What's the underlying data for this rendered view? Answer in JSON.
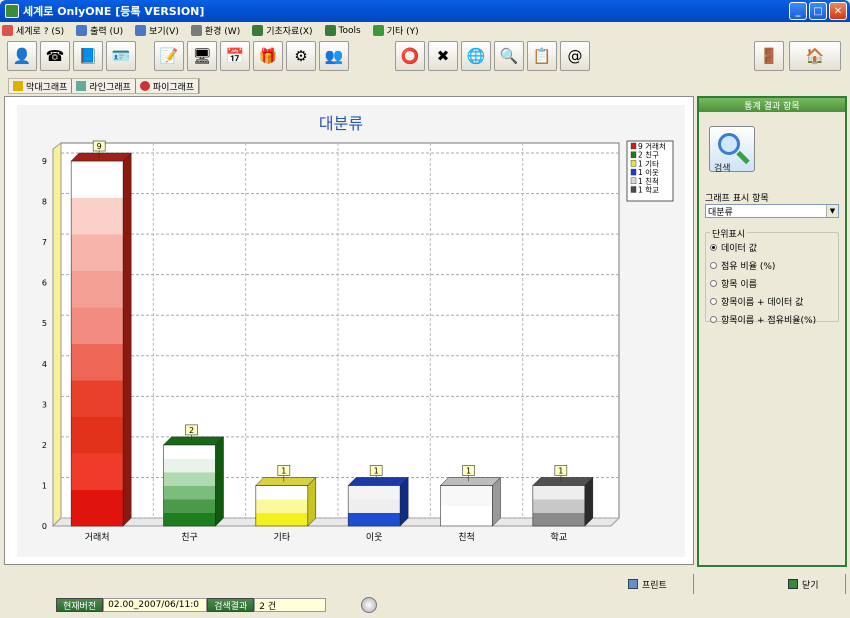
{
  "window": {
    "title": "세계로 OnlyONE [등록 VERSION]"
  },
  "menu": [
    {
      "label": "세계로 ? (S)",
      "icon": "person-icon",
      "color": "#d9534f"
    },
    {
      "label": "출력 (U)",
      "icon": "printer-icon",
      "color": "#4a78c2"
    },
    {
      "label": "보기(V)",
      "icon": "magnifier-icon",
      "color": "#4a78c2"
    },
    {
      "label": "환경 (W)",
      "icon": "settings-icon",
      "color": "#7a7a7a"
    },
    {
      "label": "기초자료(X)",
      "icon": "database-icon",
      "color": "#3a7a3a"
    },
    {
      "label": "Tools",
      "icon": "tools-icon",
      "color": "#3a7a3a"
    },
    {
      "label": "기타 (Y)",
      "icon": "star-icon",
      "color": "#3a9a3a"
    }
  ],
  "toolbar": {
    "buttons": [
      {
        "name": "person-icon",
        "glyph": "👤"
      },
      {
        "name": "phone-icon",
        "glyph": "☎"
      },
      {
        "name": "book-icon",
        "glyph": "📘"
      },
      {
        "name": "user-card-icon",
        "glyph": "🪪"
      },
      {
        "name": "edit-icon",
        "glyph": "📝"
      },
      {
        "name": "monitor-icon",
        "glyph": "🖥"
      },
      {
        "name": "calendar-icon",
        "glyph": "📅"
      },
      {
        "name": "gift-icon",
        "glyph": "🎁"
      },
      {
        "name": "gear-icon",
        "glyph": "⚙"
      },
      {
        "name": "people-icon",
        "glyph": "👥"
      },
      {
        "name": "lifebuoy-icon",
        "glyph": "⭕"
      },
      {
        "name": "excel-icon",
        "glyph": "✖"
      },
      {
        "name": "internet-icon",
        "glyph": "🌐"
      },
      {
        "name": "search-doc-icon",
        "glyph": "🔍"
      },
      {
        "name": "clipboard-icon",
        "glyph": "📋"
      },
      {
        "name": "email-icon",
        "glyph": "@"
      },
      {
        "name": "exit-door-icon",
        "glyph": "🚪"
      },
      {
        "name": "logo-icon",
        "glyph": "🏠"
      }
    ]
  },
  "tabs": [
    {
      "label": "막대그래프",
      "icon": "bar-chart-icon"
    },
    {
      "label": "라인그래프",
      "icon": "line-chart-icon"
    },
    {
      "label": "파이그래프",
      "icon": "pie-chart-icon"
    }
  ],
  "right_panel": {
    "header": "통계 결과 항목",
    "search_label": "검색",
    "graph_item_label": "그래프 표시 항목",
    "graph_item_value": "대분류",
    "unit_title": "단위표시",
    "unit_options": [
      {
        "label": "데이터 값",
        "selected": true
      },
      {
        "label": "점유 비율 (%)",
        "selected": false
      },
      {
        "label": "항목 이름",
        "selected": false
      },
      {
        "label": "항목이름 + 데이터 값",
        "selected": false
      },
      {
        "label": "항목이름 + 점유비율(%)",
        "selected": false
      }
    ]
  },
  "buttons": {
    "print": "프린트",
    "close": "닫기"
  },
  "status": {
    "version_label": "현재버전",
    "version_value": "02.00_2007/06/11:0",
    "result_label": "검색결과",
    "result_value": "2 건"
  },
  "chart_data": {
    "type": "bar",
    "title": "대분류",
    "categories": [
      "거래처",
      "친구",
      "기타",
      "이웃",
      "친척",
      "학교"
    ],
    "values": [
      9,
      2,
      1,
      1,
      1,
      1
    ],
    "ylim": [
      0,
      9
    ],
    "yticks": [
      0,
      1,
      2,
      3,
      4,
      5,
      6,
      7,
      8,
      9
    ],
    "grid": true,
    "legend_position": "top-right",
    "legend": [
      "9 거래처",
      "2 친구",
      "1 기타",
      "1 이웃",
      "1 친척",
      "1 학교"
    ],
    "colors": [
      "#c8201c",
      "#1d7a1d",
      "#e8e430",
      "#1d3fbf",
      "#d8d8d8",
      "#4a4a4a"
    ]
  }
}
